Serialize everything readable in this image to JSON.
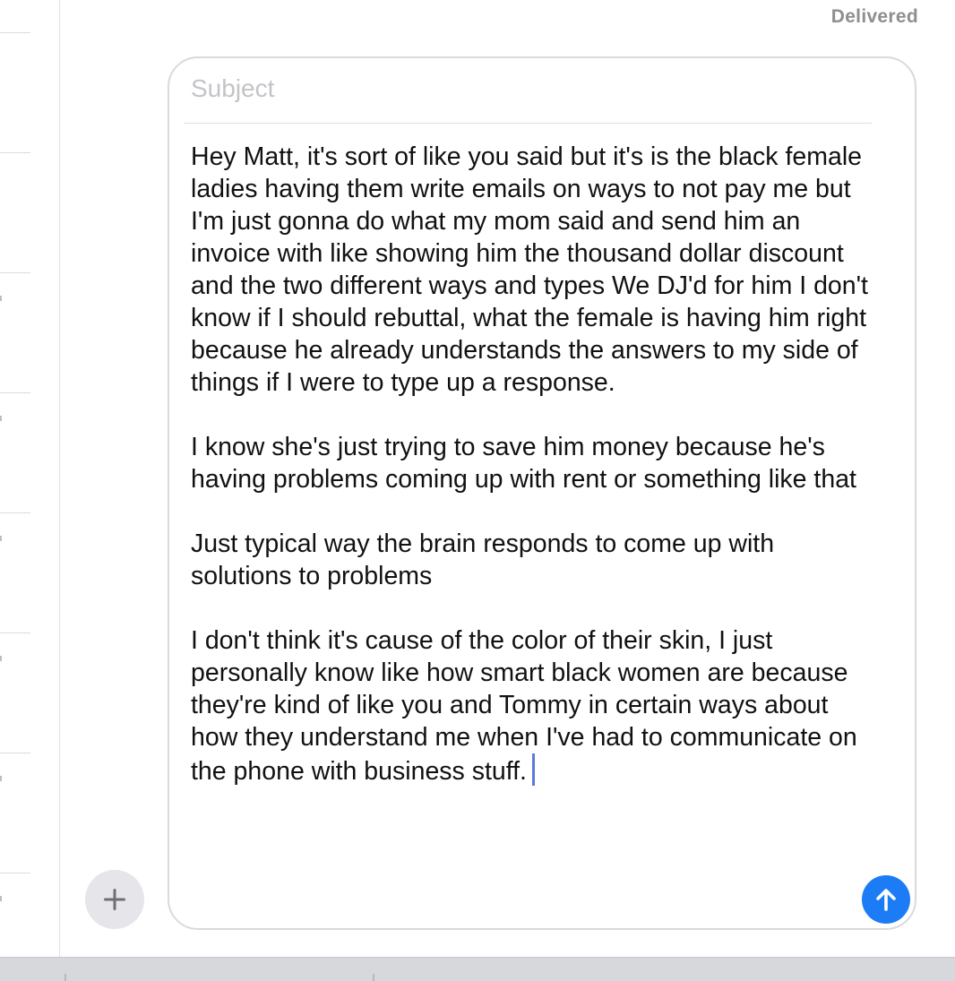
{
  "status": {
    "delivered_label": "Delivered"
  },
  "compose": {
    "subject_placeholder": "Subject",
    "body": "Hey Matt, it's sort of like you said but it's is the black female ladies having them write emails on ways to not pay me but I'm just gonna do what my mom said and send him an invoice with like showing him the thousand dollar discount and the two different ways and types We DJ'd for him I don't know if I should rebuttal, what the female is having him right because he already understands the answers to my side of things if I were to type up a response.\n\nI know she's just trying to save him money because he's having problems coming up with rent or something like that\n\nJust typical way the brain responds to come up with solutions to problems\n\nI don't think it's cause of the color of their skin, I just personally know like how smart black women are because they're kind of like you and Tommy in certain ways about how they understand me when I've had to communicate on the phone with business stuff."
  },
  "actions": {
    "plus_icon": "plus-icon",
    "send_icon": "arrow-up-icon"
  },
  "colors": {
    "accent": "#1c7cf5",
    "status_text": "#8e8e93",
    "placeholder": "#c4c4c8"
  }
}
